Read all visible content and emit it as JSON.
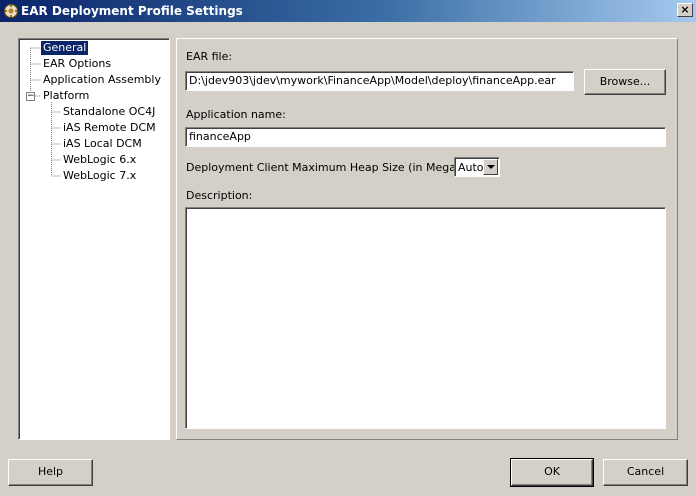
{
  "window": {
    "title": "EAR Deployment Profile Settings",
    "close_glyph": "×",
    "icon": "app-icon"
  },
  "tree": {
    "expander_glyph": "−",
    "items": [
      {
        "label": "General",
        "selected": true
      },
      {
        "label": "EAR Options"
      },
      {
        "label": "Application Assembly"
      },
      {
        "label": "Platform",
        "expanded": true
      },
      {
        "label": "Standalone OC4J"
      },
      {
        "label": "iAS Remote DCM"
      },
      {
        "label": "iAS Local DCM"
      },
      {
        "label": "WebLogic 6.x"
      },
      {
        "label": "WebLogic 7.x"
      }
    ]
  },
  "general": {
    "ear_file_label": "EAR file:",
    "ear_file_value": "D:\\jdev903\\jdev\\mywork\\FinanceApp\\Model\\deploy\\financeApp.ear",
    "browse_label": "Browse...",
    "app_name_label": "Application name:",
    "app_name_value": "financeApp",
    "heap_label": "Deployment Client Maximum Heap Size (in Megabytes):",
    "heap_value": "Auto",
    "description_label": "Description:",
    "description_value": ""
  },
  "footer": {
    "help_label": "Help",
    "ok_label": "OK",
    "cancel_label": "Cancel"
  },
  "colors": {
    "titlebar_start": "#0a246a",
    "titlebar_end": "#a6caf0",
    "dialog_bg": "#d4d0c8",
    "selection": "#0a246a"
  }
}
